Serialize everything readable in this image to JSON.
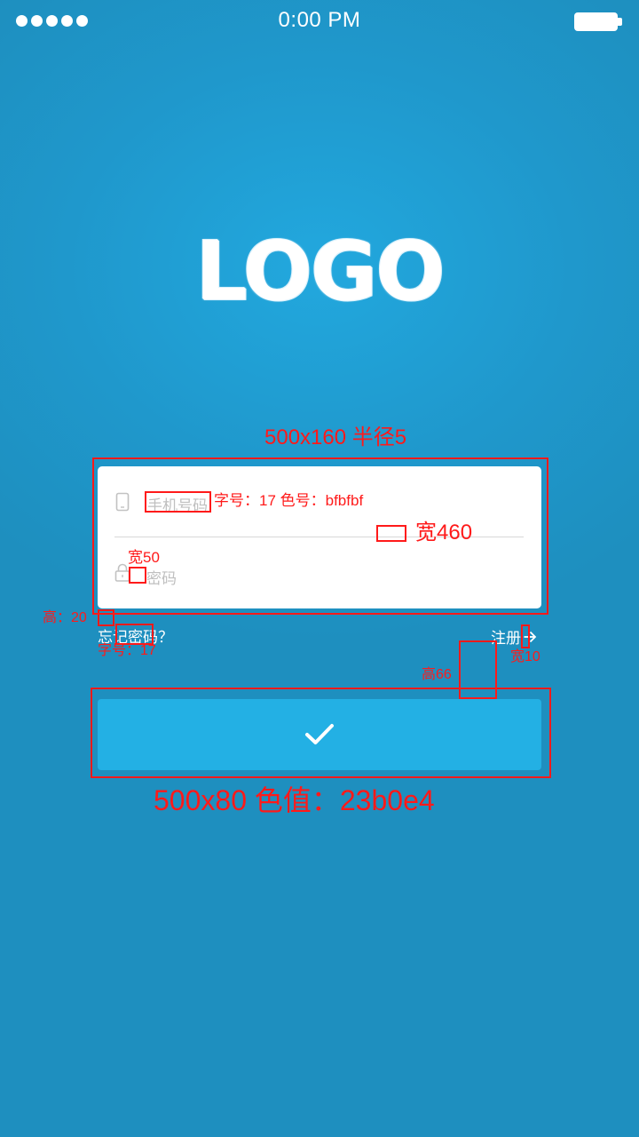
{
  "status_bar": {
    "time": "0:00 PM",
    "signal_dots": 5
  },
  "logo": {
    "text": "LOGO"
  },
  "login_form": {
    "phone_placeholder": "手机号码",
    "password_placeholder": "密码",
    "forgot_password": "忘记密码？",
    "register": "注册",
    "submit_icon": "checkmark-icon"
  },
  "annotations": {
    "card_size": "500x160 半径5",
    "phone_font_spec": "字号：17 色号：bfbfbf",
    "divider_width": "宽460",
    "icon_width": "宽50",
    "gap_height": "高：20",
    "forgot_font_size": "字号：17",
    "arrow_width": "宽10",
    "link_gap_height": "高66",
    "button_spec": "500x80  色值：23b0e4"
  },
  "colors": {
    "background": "#1e8fbf",
    "button": "#23b0e4",
    "placeholder": "#bfbfbf",
    "annotation": "#ff1a1a"
  }
}
